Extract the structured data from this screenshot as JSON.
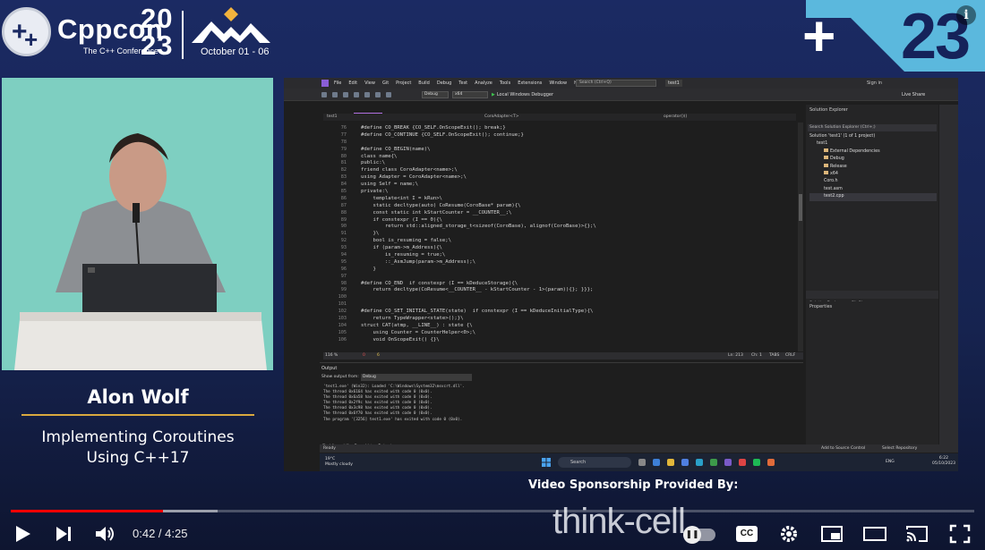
{
  "banner": {
    "brand_name": "Cppcon",
    "brand_sub": "The C++ Conference",
    "year": "20 23",
    "dates": "October 01 - 06",
    "corner_plus": "+",
    "corner_num": "23"
  },
  "speaker": {
    "name": "Alon Wolf",
    "talk_title_line1": "Implementing Coroutines",
    "talk_title_line2": "Using C++17"
  },
  "ide": {
    "menu": [
      "File",
      "Edit",
      "View",
      "Git",
      "Project",
      "Build",
      "Debug",
      "Test",
      "Analyze",
      "Tools",
      "Extensions",
      "Window",
      "Help"
    ],
    "search_placeholder": "Search (Ctrl+Q)",
    "project_name": "test1",
    "sign_in": "Sign in",
    "live_share": "Live Share",
    "config_debug": "Debug",
    "config_platform": "x64",
    "run_target": "Local Windows Debugger",
    "tabs": [
      {
        "label": "test.asm",
        "active": false
      },
      {
        "label": "Coro.h",
        "active": true
      },
      {
        "label": "test2.cpp",
        "active": false
      }
    ],
    "nav_scope": "test1",
    "nav_member": "CoroAdapter<T>",
    "nav_func": "operator()()",
    "code_lines": [
      {
        "n": "76",
        "t": "#define CO_BREAK {CO_SELF.OnScopeExit(); break;}"
      },
      {
        "n": "77",
        "t": "#define CO_CONTINUE {CO_SELF.OnScopeExit(); continue;}"
      },
      {
        "n": "78",
        "t": ""
      },
      {
        "n": "79",
        "t": "#define CO_BEGIN(name)\\"
      },
      {
        "n": "80",
        "t": "class name{\\"
      },
      {
        "n": "81",
        "t": "public:\\"
      },
      {
        "n": "82",
        "t": "friend class CoroAdapter<name>;\\"
      },
      {
        "n": "83",
        "t": "using Adapter = CoroAdapter<name>;\\"
      },
      {
        "n": "84",
        "t": "using Self = name;\\"
      },
      {
        "n": "85",
        "t": "private:\\"
      },
      {
        "n": "86",
        "t": "    template<int I = kRun>\\"
      },
      {
        "n": "87",
        "t": "    static decltype(auto) CoResume(CoroBase* param){\\"
      },
      {
        "n": "88",
        "t": "    const static int kStartCounter = __COUNTER__;\\"
      },
      {
        "n": "89",
        "t": "    if constexpr (I == 0){\\"
      },
      {
        "n": "90",
        "t": "        return std::aligned_storage_t<sizeof(CoroBase), alignof(CoroBase)>{};\\"
      },
      {
        "n": "91",
        "t": "    }\\"
      },
      {
        "n": "92",
        "t": "    bool is_resuming = false;\\"
      },
      {
        "n": "93",
        "t": "    if (param->m_Address){\\"
      },
      {
        "n": "94",
        "t": "        is_resuming = true;\\"
      },
      {
        "n": "95",
        "t": "        ::_AsmJump(param->m_Address);\\"
      },
      {
        "n": "96",
        "t": "    }"
      },
      {
        "n": "97",
        "t": ""
      },
      {
        "n": "98",
        "t": "#define CO_END  if constexpr (I == kDeduceStorage){\\"
      },
      {
        "n": "99",
        "t": "    return decltype(CoResume<__COUNTER__ - kStartCounter - 1>(param)){}; }}};"
      },
      {
        "n": "100",
        "t": ""
      },
      {
        "n": "101",
        "t": ""
      },
      {
        "n": "102",
        "t": "#define CO_SET_INITIAL_STATE(state)  if constexpr (I == kDeduceInitialType){\\"
      },
      {
        "n": "103",
        "t": "    return TypeWrapper<state>();}\\"
      },
      {
        "n": "104",
        "t": "struct CAT(atmp, __LINE__) : state {\\"
      },
      {
        "n": "105",
        "t": "    using Counter = CounterHelper<0>;\\"
      },
      {
        "n": "106",
        "t": "    void OnScopeExit() {}\\"
      }
    ],
    "status": {
      "zoom": "116 %",
      "errors": "0",
      "warnings": "6",
      "line": "Ln: 213",
      "col": "Ch: 1",
      "tabs": "TABS",
      "eol": "CRLF"
    },
    "solution_explorer": {
      "title": "Solution Explorer",
      "search": "Search Solution Explorer (Ctrl+;)",
      "items": [
        {
          "label": "Solution 'test1' (1 of 1 project)",
          "indent": 0,
          "folder": false,
          "sel": false
        },
        {
          "label": "test1",
          "indent": 1,
          "folder": false,
          "sel": false
        },
        {
          "label": "External Dependencies",
          "indent": 2,
          "folder": true,
          "sel": false
        },
        {
          "label": "Debug",
          "indent": 2,
          "folder": true,
          "sel": false
        },
        {
          "label": "Release",
          "indent": 2,
          "folder": true,
          "sel": false
        },
        {
          "label": "x64",
          "indent": 2,
          "folder": true,
          "sel": false
        },
        {
          "label": "Coro.h",
          "indent": 2,
          "folder": false,
          "sel": false
        },
        {
          "label": "test.asm",
          "indent": 2,
          "folder": false,
          "sel": false
        },
        {
          "label": "test2.cpp",
          "indent": 2,
          "folder": false,
          "sel": true
        }
      ],
      "tabs": [
        "Solution Explorer",
        "Git Changes"
      ]
    },
    "properties_title": "Properties",
    "output": {
      "title": "Output",
      "show_from_label": "Show output from:",
      "source": "Debug",
      "lines": [
        "'test1.exe' (Win32): Loaded 'C:\\Windows\\System32\\msvcrt.dll'.",
        "The thread 0x6164 has exited with code 0 (0x0).",
        "The thread 0x6a58 has exited with code 0 (0x0).",
        "The thread 0x2f9c has exited with code 0 (0x0).",
        "The thread 0x3c98 has exited with code 0 (0x0).",
        "The thread 0x6f70 has exited with code 0 (0x0).",
        "The program '[3256] test1.exe' has exited with code 0 (0x0)."
      ],
      "tabs": [
        "Find \"ospeld\"",
        "Error List",
        "Output"
      ]
    },
    "statusbar": {
      "ready": "Ready",
      "source_control": "Add to Source Control",
      "repo": "Select Repository"
    },
    "taskbar": {
      "weather_temp": "19°C",
      "weather_desc": "Mostly cloudy",
      "search": "Search",
      "lang": "ENG",
      "time": "6:22",
      "date": "05/10/2023"
    }
  },
  "sponsor": {
    "text": "Video Sponsorship Provided By:",
    "logo": "think-cell"
  },
  "player": {
    "current_time": "0:42",
    "duration": "4:25",
    "time_display": "0:42 / 4:25",
    "played_fraction": 0.158,
    "buffered_fraction": 0.215,
    "cc_label": "CC",
    "colors": {
      "played": "#ff0000",
      "accent_gold": "#d9a93f"
    }
  }
}
